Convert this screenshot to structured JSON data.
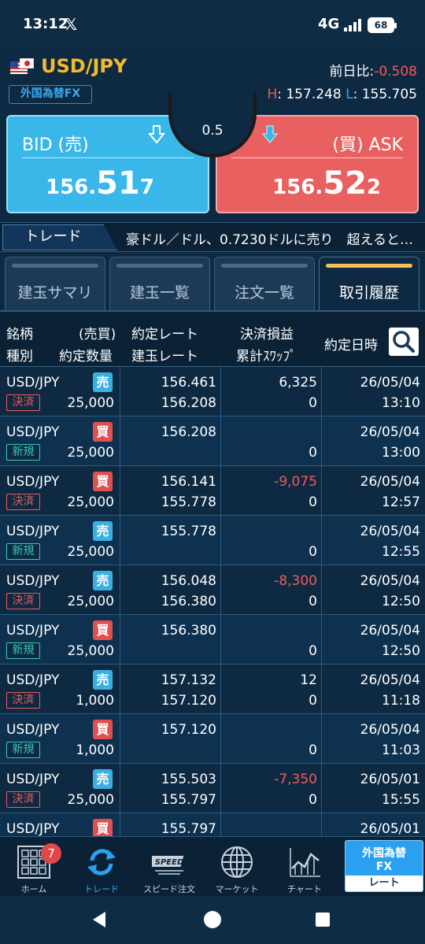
{
  "status_bar": {
    "time": "13:12",
    "x_glyph": "𝕏",
    "network": "4G",
    "battery": "68"
  },
  "header": {
    "pair": "USD/JPY",
    "market": "外国為替FX",
    "change_label": "前日比:",
    "change_value": "-0.508",
    "high_key": "H",
    "high_value": ": 157.248",
    "low_key": "L",
    "low_value": ": 155.705"
  },
  "bid": {
    "label": "BID (売)",
    "price_small": "156.",
    "price_big": "51",
    "price_tail": "7"
  },
  "ask": {
    "label": "(買) ASK",
    "price_small": "156.",
    "price_big": "52",
    "price_tail": "2"
  },
  "spread": "0.5",
  "ticker": {
    "tab_label": "トレード",
    "text": "豪ドル／ドル、0.7230ドルに売り　超えると…"
  },
  "tabs": [
    {
      "label": "建玉サマリ"
    },
    {
      "label": "建玉一覧"
    },
    {
      "label": "注文一覧"
    },
    {
      "label": "取引履歴"
    }
  ],
  "columns": {
    "c1a": "銘柄",
    "c1b": "(売買)",
    "c2a": "種別",
    "c2b": "約定数量",
    "c3a": "約定レート",
    "c3b": "建玉レート",
    "c4a": "決済損益",
    "c4b": "累計ｽﾜｯﾌﾟ",
    "c5": "約定日時"
  },
  "rows": [
    {
      "symbol": "USD/JPY",
      "side": "売",
      "kind": "決済",
      "qty": "25,000",
      "rate": "156.461",
      "open_rate": "156.208",
      "pl": "6,325",
      "swap": "0",
      "date": "26/05/04",
      "time": "13:10"
    },
    {
      "symbol": "USD/JPY",
      "side": "買",
      "kind": "新規",
      "qty": "25,000",
      "rate": "156.208",
      "open_rate": "",
      "pl": "",
      "swap": "0",
      "date": "26/05/04",
      "time": "13:00"
    },
    {
      "symbol": "USD/JPY",
      "side": "買",
      "kind": "決済",
      "qty": "25,000",
      "rate": "156.141",
      "open_rate": "155.778",
      "pl": "-9,075",
      "swap": "0",
      "date": "26/05/04",
      "time": "12:57"
    },
    {
      "symbol": "USD/JPY",
      "side": "売",
      "kind": "新規",
      "qty": "25,000",
      "rate": "155.778",
      "open_rate": "",
      "pl": "",
      "swap": "0",
      "date": "26/05/04",
      "time": "12:55"
    },
    {
      "symbol": "USD/JPY",
      "side": "売",
      "kind": "決済",
      "qty": "25,000",
      "rate": "156.048",
      "open_rate": "156.380",
      "pl": "-8,300",
      "swap": "0",
      "date": "26/05/04",
      "time": "12:50"
    },
    {
      "symbol": "USD/JPY",
      "side": "買",
      "kind": "新規",
      "qty": "25,000",
      "rate": "156.380",
      "open_rate": "",
      "pl": "",
      "swap": "0",
      "date": "26/05/04",
      "time": "12:50"
    },
    {
      "symbol": "USD/JPY",
      "side": "売",
      "kind": "決済",
      "qty": "1,000",
      "rate": "157.132",
      "open_rate": "157.120",
      "pl": "12",
      "swap": "0",
      "date": "26/05/04",
      "time": "11:18"
    },
    {
      "symbol": "USD/JPY",
      "side": "買",
      "kind": "新規",
      "qty": "1,000",
      "rate": "157.120",
      "open_rate": "",
      "pl": "",
      "swap": "0",
      "date": "26/05/04",
      "time": "11:03"
    },
    {
      "symbol": "USD/JPY",
      "side": "売",
      "kind": "決済",
      "qty": "25,000",
      "rate": "155.503",
      "open_rate": "155.797",
      "pl": "-7,350",
      "swap": "0",
      "date": "26/05/01",
      "time": "15:55"
    },
    {
      "symbol": "USD/JPY",
      "side": "買",
      "kind": "",
      "qty": "",
      "rate": "155.797",
      "open_rate": "",
      "pl": "",
      "swap": "",
      "date": "26/05/01",
      "time": ""
    }
  ],
  "bottom_nav": {
    "home": "ホーム",
    "home_badge": "7",
    "trade": "トレード",
    "speed_order": "スピード注文",
    "speed_text": "SPEED",
    "market": "マーケット",
    "chart": "チャート",
    "fx_l1": "外国為替",
    "fx_l2": "FX",
    "fx_l3": "レート"
  },
  "colors": {
    "accent_yellow": "#f5b92e",
    "bid_blue": "#38b7e8",
    "ask_red": "#e86060",
    "negative": "#f05a5a",
    "new_teal": "#3ac8b8"
  }
}
